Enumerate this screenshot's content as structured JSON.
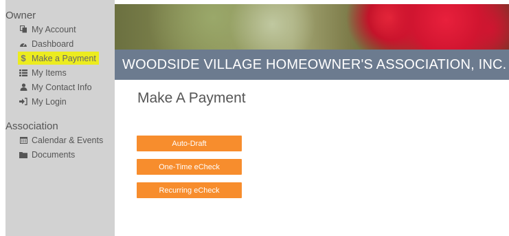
{
  "sidebar": {
    "owner_title": "Owner",
    "owner_items": [
      {
        "label": "My Account",
        "icon": "copy-icon"
      },
      {
        "label": "Dashboard",
        "icon": "dashboard-icon"
      },
      {
        "label": "Make a Payment",
        "icon": "dollar-icon",
        "active": true
      },
      {
        "label": "My Items",
        "icon": "list-icon"
      },
      {
        "label": "My Contact Info",
        "icon": "user-icon"
      },
      {
        "label": "My Login",
        "icon": "sign-in-icon"
      }
    ],
    "association_title": "Association",
    "association_items": [
      {
        "label": "Calendar & Events",
        "icon": "calendar-icon"
      },
      {
        "label": "Documents",
        "icon": "folder-icon"
      }
    ]
  },
  "header": {
    "title": "WOODSIDE VILLAGE HOMEOWNER'S ASSOCIATION, INC."
  },
  "main": {
    "page_title": "Make A Payment",
    "buttons": [
      "Auto-Draft",
      "One-Time eCheck",
      "Recurring eCheck"
    ]
  },
  "colors": {
    "sidebar_bg": "#d2d2d2",
    "active_highlight": "#ecec1f",
    "banner_bar": "#6c7b8f",
    "button": "#f78d2d"
  }
}
